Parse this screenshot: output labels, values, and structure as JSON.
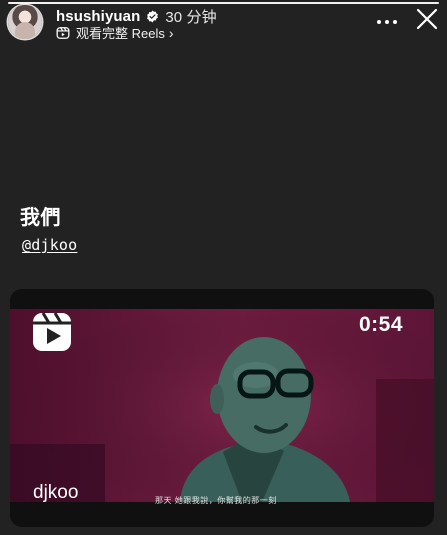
{
  "story": {
    "progress": 1
  },
  "header": {
    "username": "hsushiyuan",
    "timestamp": "30 分钟",
    "watch_full_label": "观看完整 Reels",
    "chevron": "›",
    "more_label": "•••",
    "close_label": "✕",
    "verified_color": "#1d9bf0"
  },
  "post": {
    "caption": "我們",
    "mention": "@djkoo"
  },
  "reel": {
    "duration": "0:54",
    "author": "djkoo",
    "subtitle": "那天 她跟我說，你幫我的那一刻",
    "tint_color": "#6a1c3e"
  }
}
